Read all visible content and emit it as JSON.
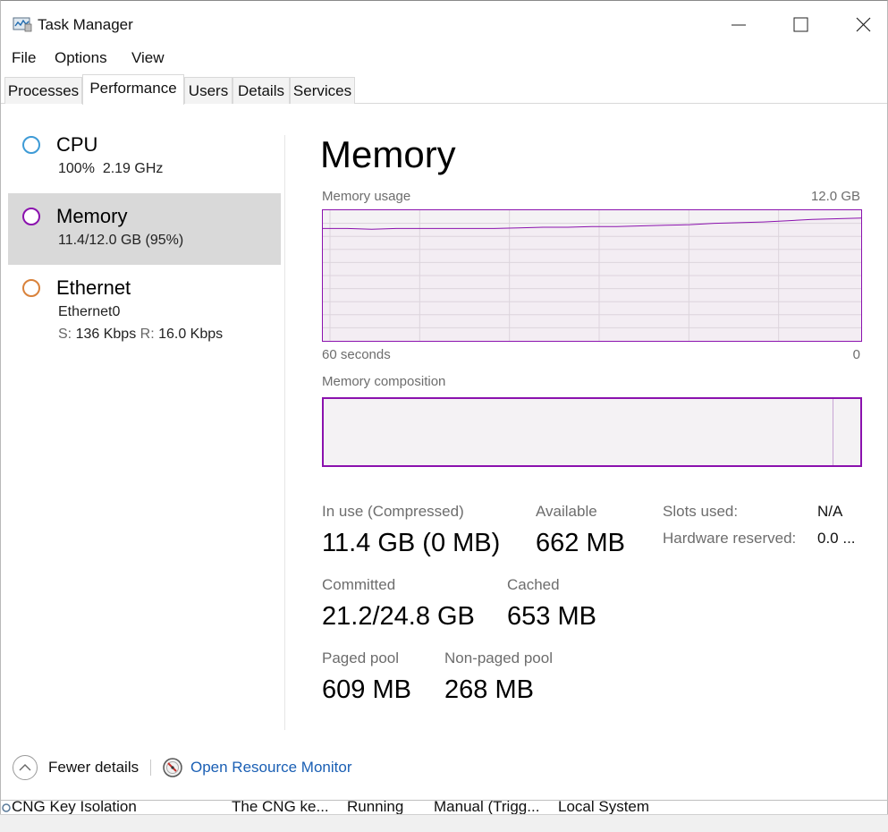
{
  "window": {
    "title": "Task Manager"
  },
  "menu": [
    "File",
    "Options",
    "View"
  ],
  "tabs": [
    "Processes",
    "Performance",
    "Users",
    "Details",
    "Services"
  ],
  "active_tab": "Performance",
  "sidebar": {
    "cpu": {
      "label": "CPU",
      "detail": "100%  2.19 GHz"
    },
    "memory": {
      "label": "Memory",
      "detail": "11.4/12.0 GB (95%)"
    },
    "ethernet": {
      "label": "Ethernet",
      "adapter": "Ethernet0",
      "send_key": "S:",
      "send_value": "136 Kbps",
      "recv_key": "R:",
      "recv_value": "16.0 Kbps"
    }
  },
  "main": {
    "title": "Memory",
    "usage_label": "Memory usage",
    "usage_max": "12.0 GB",
    "axis_left": "60 seconds",
    "axis_right": "0",
    "composition_label": "Memory composition",
    "usage_series": [
      0.86,
      0.86,
      0.855,
      0.86,
      0.86,
      0.86,
      0.86,
      0.86,
      0.865,
      0.87,
      0.87,
      0.875,
      0.875,
      0.88,
      0.885,
      0.89,
      0.9,
      0.905,
      0.91,
      0.92,
      0.93,
      0.935,
      0.94
    ],
    "composition_in_use_fraction": 0.948
  },
  "stats": {
    "in_use_label": "In use (Compressed)",
    "in_use_value": "11.4 GB (0 MB)",
    "available_label": "Available",
    "available_value": "662 MB",
    "committed_label": "Committed",
    "committed_value": "21.2/24.8 GB",
    "cached_label": "Cached",
    "cached_value": "653 MB",
    "paged_label": "Paged pool",
    "paged_value": "609 MB",
    "nonpaged_label": "Non-paged pool",
    "nonpaged_value": "268 MB",
    "slots_label": "Slots used:",
    "slots_value": "N/A",
    "hw_label": "Hardware reserved:",
    "hw_value": "0.0 ..."
  },
  "footer": {
    "fewer_details": "Fewer details",
    "open_resource_monitor": "Open Resource Monitor"
  },
  "background_row": {
    "name": "CNG Key Isolation",
    "description": "The CNG ke...",
    "status": "Running",
    "startup": "Manual (Trigg...",
    "logon": "Local System"
  },
  "colors": {
    "memory_accent": "#8b12ae",
    "cpu_ring": "#3e9bd6",
    "ethernet_ring": "#d9823b",
    "link": "#1a5fb4"
  }
}
